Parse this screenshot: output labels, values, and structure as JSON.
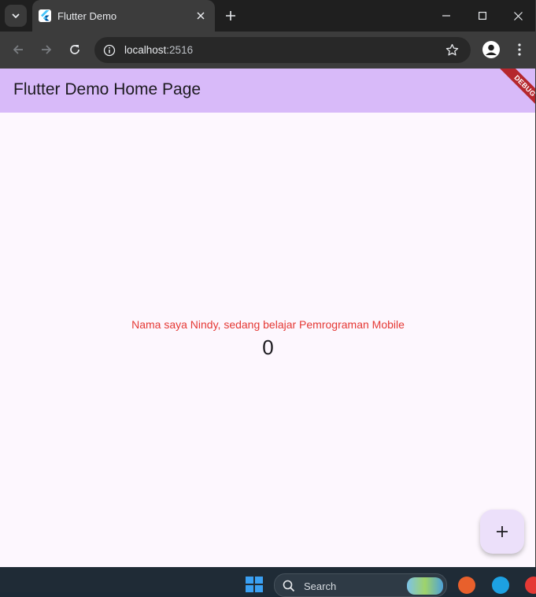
{
  "browser": {
    "tab_title": "Flutter Demo",
    "url_host": "localhost",
    "url_port": ":2516"
  },
  "app": {
    "title": "Flutter Demo Home Page",
    "debug_label": "DEBUG",
    "message": "Nama saya Nindy, sedang belajar Pemrograman Mobile",
    "counter": "0",
    "fab_icon": "plus-icon"
  },
  "taskbar": {
    "search_label": "Search"
  },
  "colors": {
    "appbar": "#d8baf9",
    "background": "#fdf7fe",
    "message": "#e53935",
    "fab": "#ece0fa"
  }
}
